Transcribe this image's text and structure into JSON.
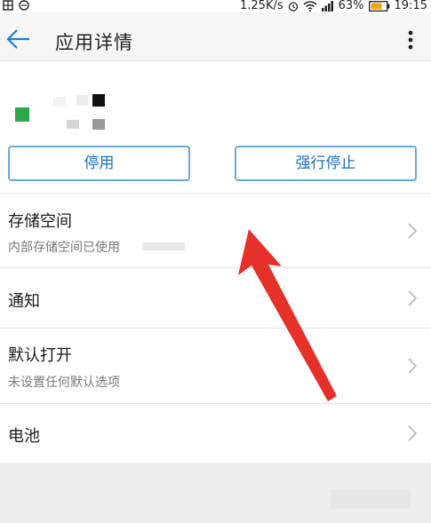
{
  "status_bar": {
    "speed": "1.25K/s",
    "battery": "63%",
    "time": "19:15"
  },
  "appbar": {
    "title": "应用详情"
  },
  "buttons": {
    "disable": "停用",
    "force_stop": "强行停止"
  },
  "rows": [
    {
      "title": "存储空间",
      "subtitle": "内部存储空间已使用"
    },
    {
      "title": "通知",
      "subtitle": ""
    },
    {
      "title": "默认打开",
      "subtitle": "未设置任何默认选项"
    },
    {
      "title": "电池",
      "subtitle": ""
    }
  ],
  "colors": {
    "accent": "#1c6fbb",
    "button_border": "#6aa8d8",
    "annotation_arrow": "#e5312a"
  },
  "icons": {
    "back": "back-arrow-icon",
    "more": "more-vert-icon",
    "chevron": "chevron-right-icon"
  }
}
